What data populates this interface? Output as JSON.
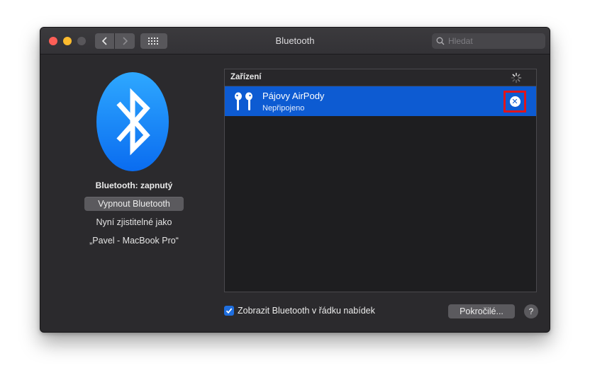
{
  "window": {
    "title": "Bluetooth"
  },
  "toolbar": {
    "back_icon": "chevron-left-icon",
    "forward_icon": "chevron-right-icon",
    "show_all_icon": "grid-icon",
    "search_placeholder": "Hledat"
  },
  "bluetooth": {
    "status": "Bluetooth: zapnutý",
    "toggle_label": "Vypnout Bluetooth",
    "discoverable_label": "Nyní zjistitelné jako",
    "discoverable_name": "„Pavel - MacBook Pro“"
  },
  "devices": {
    "header": "Zařízení",
    "items": [
      {
        "name": "Pájovy AirPody",
        "status": "Nepřipojeno",
        "icon": "airpods-icon",
        "selected": true
      }
    ]
  },
  "footer": {
    "show_in_menu_label": "Zobrazit Bluetooth v řádku nabídek",
    "show_in_menu_checked": true,
    "advanced_label": "Pokročilé...",
    "help_label": "?"
  },
  "colors": {
    "accent": "#0d5bd2",
    "highlight_box": "#e0151c",
    "window_bg": "#2b2a2d"
  }
}
